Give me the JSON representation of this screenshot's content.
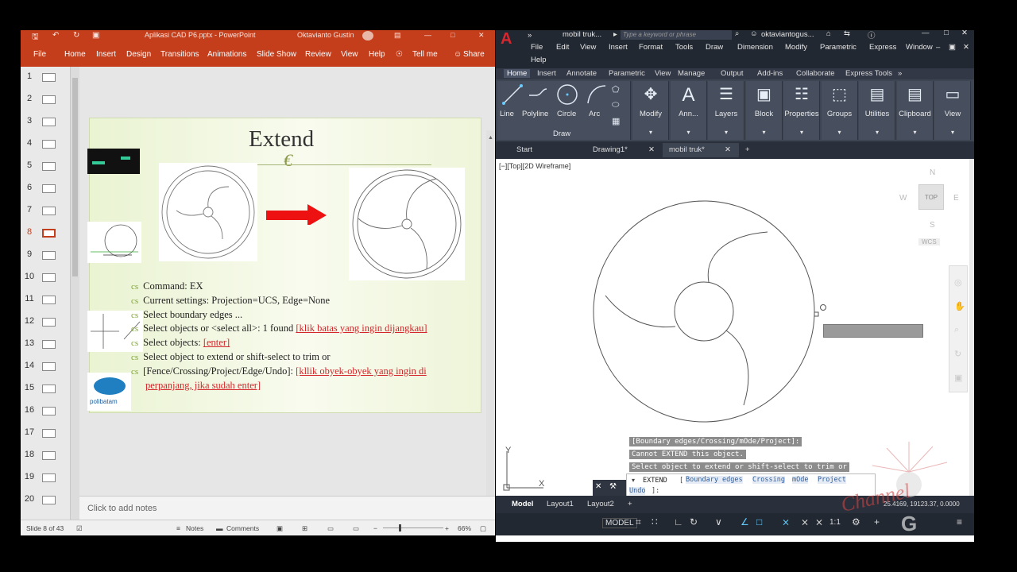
{
  "ppt": {
    "title_left_icons": [
      "save-icon",
      "undo-icon",
      "redo-icon",
      "present-icon"
    ],
    "file_title": "Aplikasi CAD P6.pptx - PowerPoint",
    "user": "Oktavianto Gustin",
    "menu": [
      "File",
      "Home",
      "Insert",
      "Design",
      "Transitions",
      "Animations",
      "Slide Show",
      "Review",
      "View",
      "Help"
    ],
    "tell_me": "Tell me",
    "share": "Share",
    "thumb_numbers": [
      "1",
      "2",
      "3",
      "4",
      "5",
      "6",
      "7",
      "8",
      "9",
      "10",
      "11",
      "12",
      "13",
      "14",
      "15",
      "16",
      "17",
      "18",
      "19",
      "20"
    ],
    "active_slide": "8",
    "slide": {
      "title": "Extend",
      "ornament": "€",
      "logo": "polibatam",
      "bullets": [
        {
          "text": "Command: EX",
          "red": ""
        },
        {
          "text": "Current settings: Projection=UCS, Edge=None",
          "red": ""
        },
        {
          "text": "Select boundary edges ...",
          "red": ""
        },
        {
          "text": "Select objects or <select all>: 1 found ",
          "red": "[klik batas yang ingin dijangkau]"
        },
        {
          "text": "Select objects: ",
          "red": "[enter]"
        },
        {
          "text": "Select object to extend or shift-select to trim or",
          "red": ""
        },
        {
          "text": "[Fence/Crossing/Project/Edge/Undo]: ",
          "red": "[kllik obyek-obyek yang ingin di"
        },
        {
          "text": "",
          "red": "perpanjang, jika sudah enter]"
        }
      ]
    },
    "notes_placeholder": "Click to add notes",
    "status": {
      "slide_of": "Slide 8 of 43",
      "notes": "Notes",
      "comments": "Comments",
      "zoom": "66%"
    }
  },
  "acad": {
    "app_letter": "A",
    "doc_title": "mobil truk...",
    "search_placeholder": "Type a keyword or phrase",
    "user": "oktaviantogus...",
    "menus": [
      "File",
      "Edit",
      "View",
      "Insert",
      "Format",
      "Tools",
      "Draw",
      "Dimension",
      "Modify",
      "Parametric",
      "Express",
      "Window",
      "Help"
    ],
    "ribbon_tabs": [
      "Home",
      "Insert",
      "Annotate",
      "Parametric",
      "View",
      "Manage",
      "Output",
      "Add-ins",
      "Collaborate",
      "Express Tools"
    ],
    "draw_tools": [
      "Line",
      "Polyline",
      "Circle",
      "Arc"
    ],
    "draw_group": "Draw",
    "panels": [
      "Modify",
      "Ann...",
      "Layers",
      "Block",
      "Properties",
      "Groups",
      "Utilities",
      "Clipboard",
      "View"
    ],
    "file_tabs": [
      "Start",
      "Drawing1*",
      "mobil truk*"
    ],
    "viewport_label": "[−][Top][2D Wireframe]",
    "viewcube": {
      "n": "N",
      "s": "S",
      "e": "E",
      "w": "W",
      "top": "TOP",
      "wcs": "WCS"
    },
    "ucs": {
      "x": "X",
      "y": "Y"
    },
    "cmd_history": [
      "[Boundary edges/Crossing/mOde/Project]:",
      "Cannot EXTEND this object.",
      "Select object to extend or shift-select to trim or"
    ],
    "cmd_prompt": "EXTEND",
    "cmd_options": [
      "Boundary edges",
      "Crossing",
      "mOde",
      "Project",
      "Undo"
    ],
    "layout_tabs": [
      "Model",
      "Layout1",
      "Layout2"
    ],
    "status": {
      "model": "MODEL",
      "scale": "1:1",
      "coords": "25.4169, 19123.37, 0.0000"
    },
    "watermark": "Channel"
  }
}
